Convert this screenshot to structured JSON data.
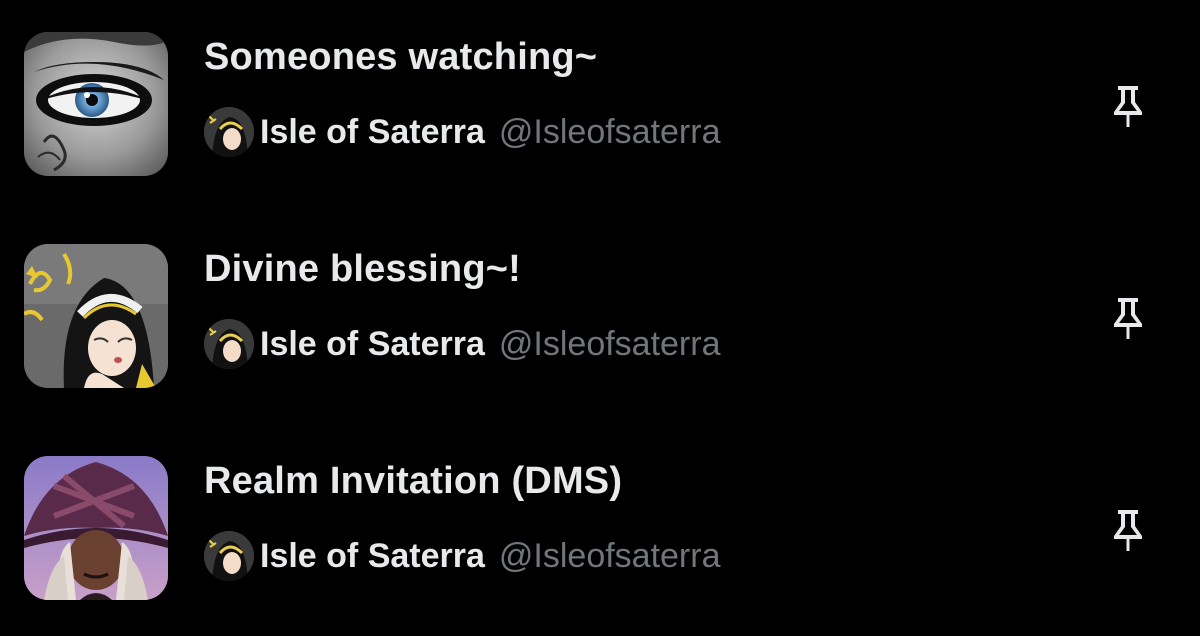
{
  "lists": [
    {
      "title": "Someones watching~",
      "owner_name": "Isle of Saterra",
      "owner_handle": "@Isleofsaterra",
      "thumbnail": "eye-closeup-image",
      "action_icon": "pin-icon"
    },
    {
      "title": "Divine blessing~!",
      "owner_name": "Isle of Saterra",
      "owner_handle": "@Isleofsaterra",
      "thumbnail": "nun-character-image",
      "action_icon": "pin-icon"
    },
    {
      "title": "Realm Invitation (DMS)",
      "owner_name": "Isle of Saterra",
      "owner_handle": "@Isleofsaterra",
      "thumbnail": "witch-character-image",
      "action_icon": "pin-icon"
    }
  ],
  "colors": {
    "background": "#000000",
    "primary_text": "#e7e9ea",
    "secondary_text": "#71767b",
    "pin_icon": "#e7e9ea"
  }
}
